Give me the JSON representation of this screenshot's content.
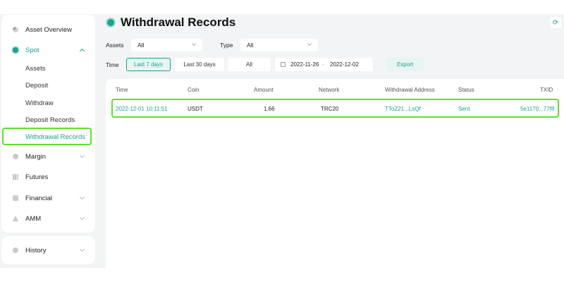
{
  "sidebar": {
    "asset_overview": "Asset Overview",
    "spot": "Spot",
    "spot_items": [
      "Assets",
      "Deposit",
      "Withdraw",
      "Deposit Records",
      "Withdrawal Records"
    ],
    "margin": "Margin",
    "futures": "Futures",
    "financial": "Financial",
    "amm": "AMM",
    "history": "History"
  },
  "header": {
    "title": "Withdrawal Records"
  },
  "filters": {
    "assets_label": "Assets",
    "assets_value": "All",
    "type_label": "Type",
    "type_value": "All",
    "time_label": "Time",
    "time_buttons": [
      "Last 7 days",
      "Last 30 days",
      "All"
    ],
    "selected_time": "Last 7 days",
    "date_start": "2022-11-26",
    "date_sep": "-",
    "date_end": "2022-12-02",
    "export_label": "Export"
  },
  "table": {
    "columns": [
      "Time",
      "Coin",
      "Amount",
      "Network",
      "Withdrawal Address",
      "Status",
      "TXID"
    ],
    "rows": [
      {
        "time": "2022-12-01 10:11:51",
        "coin": "USDT",
        "amount": "1.66",
        "network": "TRC20",
        "address": "TToZ21...LsQf",
        "status": "Sent",
        "txid": "5e1170...77f8"
      }
    ]
  },
  "colors": {
    "accent": "#1ea08f",
    "highlight": "#5ee02c",
    "background": "#f2f4f5"
  },
  "icons": [
    "pie-chart-icon",
    "spot-gear-icon",
    "margin-icon",
    "futures-icon",
    "financial-icon",
    "amm-icon",
    "history-icon",
    "title-icon",
    "refresh-icon",
    "calendar-icon"
  ]
}
